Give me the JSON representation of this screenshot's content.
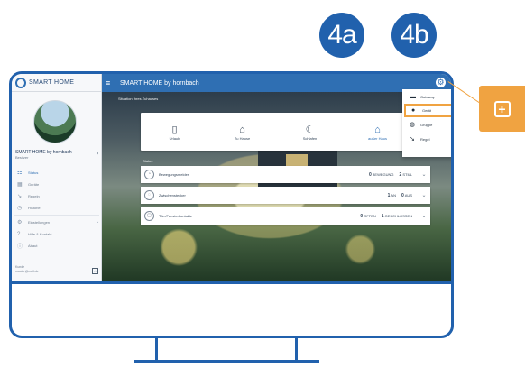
{
  "callouts": {
    "step_a": "4a",
    "step_b": "4b"
  },
  "app": {
    "logo_text": "SMART HOME",
    "window_title": "SMART HOME by hornbach"
  },
  "sidebar": {
    "profile_name": "SMART HOME by hornbach",
    "profile_role": "Besitzer",
    "items": [
      {
        "label": "Status",
        "icon": "status-icon"
      },
      {
        "label": "Geräte",
        "icon": "devices-icon"
      },
      {
        "label": "Regeln",
        "icon": "rules-icon"
      },
      {
        "label": "Historie",
        "icon": "history-icon"
      },
      {
        "label": "Einstellungen",
        "icon": "settings-icon"
      },
      {
        "label": "Hilfe & Kontakt",
        "icon": "help-icon"
      },
      {
        "label": "Abaut",
        "icon": "info-icon"
      }
    ],
    "user_label": "Kunde",
    "user_email": "muster@mail.de"
  },
  "content": {
    "scenes_label": "Situation Ihres Zuhauses",
    "status_label": "Status",
    "scenes": [
      {
        "label": "Urlaub",
        "icon": "vacation-icon"
      },
      {
        "label": "Zu Hause",
        "icon": "home-icon"
      },
      {
        "label": "Schlafen",
        "icon": "sleep-icon"
      },
      {
        "label": "außer Haus",
        "icon": "away-icon"
      }
    ],
    "status_rows": [
      {
        "label": "Bewegungsmelder",
        "icon": "motion-sensor-icon",
        "stat1_value": "0",
        "stat1_label": "BEWEGUNG",
        "stat2_value": "2",
        "stat2_label": "STILL"
      },
      {
        "label": "Zwischenstecker",
        "icon": "smart-plug-icon",
        "stat1_value": "1",
        "stat1_label": "AN",
        "stat2_value": "0",
        "stat2_label": "AUS"
      },
      {
        "label": "Tür-/Fensterkontakte",
        "icon": "door-window-contact-icon",
        "stat1_value": "0",
        "stat1_label": "OFFEN",
        "stat2_value": "1",
        "stat2_label": "GESCHLOSSEN"
      }
    ]
  },
  "add_menu": {
    "items": [
      {
        "label": "Gateway",
        "icon": "gateway-icon"
      },
      {
        "label": "Gerät",
        "icon": "device-icon"
      },
      {
        "label": "Gruppe",
        "icon": "group-icon"
      },
      {
        "label": "Regel",
        "icon": "rule-icon"
      }
    ]
  },
  "colors": {
    "brand_blue": "#2161ad",
    "accent_orange": "#f0a341"
  }
}
